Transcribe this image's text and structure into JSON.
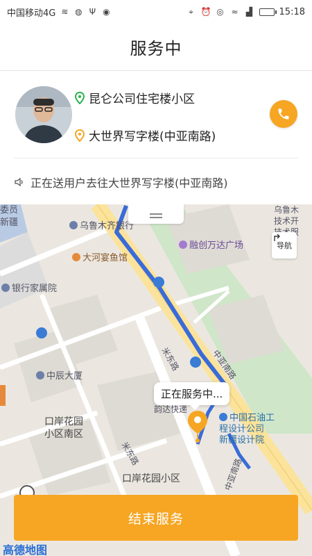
{
  "status_bar": {
    "carrier": "中国移动4G",
    "time": "15:18"
  },
  "header": {
    "title": "服务中"
  },
  "trip": {
    "start_location": "昆仑公司住宅楼小区",
    "end_location": "大世界写字楼(中亚南路)",
    "notice": "正在送用户去往大世界写字楼(中亚南路)"
  },
  "map": {
    "labels": {
      "poi_1": "乌鲁木齐银行",
      "poi_2": "大河宴鱼馆",
      "poi_3": "融创万达广场",
      "poi_4": "银行家属院",
      "poi_5": "中辰大厦",
      "poi_6": "口岸花园\n小区南区",
      "poi_7": "中国石油工\n程设计公司\n新疆设计院",
      "poi_8": "口岸花园小区",
      "poi_9": "韵达快递",
      "road_1": "米东路",
      "road_2": "中亚南路",
      "road_3": "米东路",
      "road_4": "中亚南路",
      "edge_top_right": "乌鲁木\n技术开\n技术服",
      "edge_top_left": "委员\n新疆"
    },
    "nav_label": "导航",
    "bubble_text": "正在服务中...",
    "logo": "高德地图"
  },
  "actions": {
    "end_service_label": "结束服务"
  },
  "colors": {
    "accent": "#f6a623",
    "start_pin": "#2bb24c",
    "end_pin": "#f6a623",
    "route": "#3a6bd8"
  }
}
